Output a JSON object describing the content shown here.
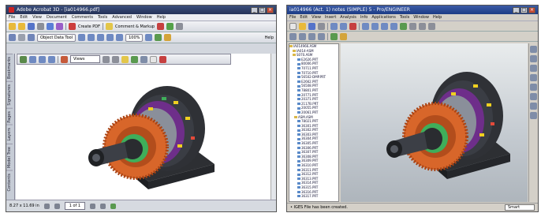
{
  "acrobat": {
    "title": "Adobe Acrobat 3D - [ia014966.pdf]",
    "menu": [
      "File",
      "Edit",
      "View",
      "Document",
      "Comments",
      "Tools",
      "Advanced",
      "Window",
      "Help"
    ],
    "toolbar": {
      "create_pdf": "Create PDF",
      "comment_markup": "Comment & Markup",
      "object_data_tool": "Object Data Tool",
      "zoom": "100%",
      "help": "Help"
    },
    "model_toolbar": {
      "views": "Views"
    },
    "side_tabs": [
      "Bookmarks",
      "Signatures",
      "Pages",
      "Layers",
      "Model Tree",
      "Contents"
    ],
    "status": {
      "size": "8.27 x 11.69 in",
      "page": "1 of 1"
    }
  },
  "proe": {
    "title": "ia014966 (Act. 1) notes (SIMPLE) 5 - Pro/ENGINEER",
    "menu": [
      "File",
      "Edit",
      "View",
      "Insert",
      "Analysis",
      "Info",
      "Applications",
      "Tools",
      "Window",
      "Help"
    ],
    "tree": [
      "IA014966.ASM",
      "IA014-ASM",
      "S070.ASM",
      "E2626.PRT",
      "80006.PRT",
      "70711.PRT",
      "70710.PRT",
      "56502-DMP.PRT",
      "E2662.PRT",
      "56508.PRT",
      "78801.PRT",
      "20771.PRT",
      "20371.PRT",
      "2117B.PRT",
      "20055.PRT",
      "20061.PRT",
      "ASM.ASM",
      "78021.PRT",
      "36301.PRT",
      "36302.PRT",
      "36303.PRT",
      "36304.PRT",
      "36305.PRT",
      "36306.PRT",
      "36307.PRT",
      "36308.PRT",
      "36309.PRT",
      "36310.PRT",
      "36311.PRT",
      "36312.PRT",
      "36313.PRT",
      "36314.PRT",
      "36315.PRT",
      "36316.PRT",
      "36317.PRT"
    ],
    "status": "• IGES File has been created.",
    "filter": "Smart"
  }
}
